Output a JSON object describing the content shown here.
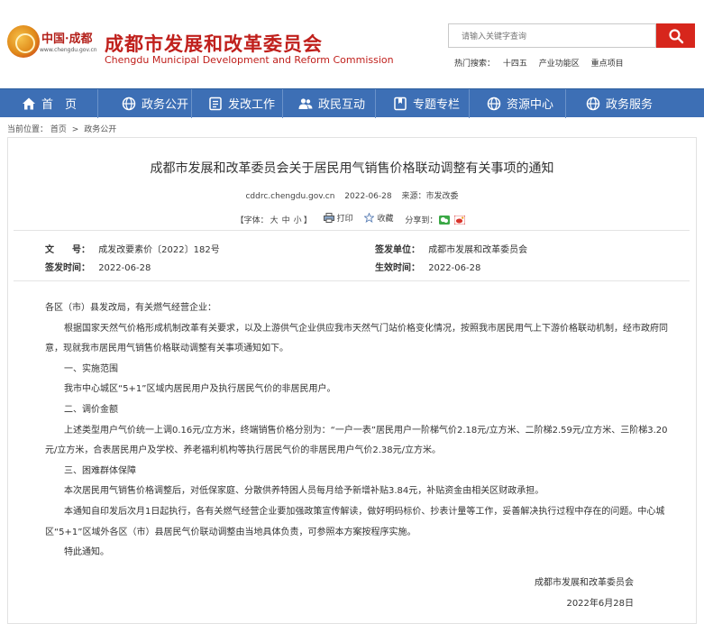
{
  "header": {
    "logo_text": "中国·成都",
    "logo_url": "www.chengdu.gov.cn",
    "title_cn": "成都市发展和改革委员会",
    "title_en": "Chengdu Municipal Development and Reform Commission",
    "search_placeholder": "请输入关键字查询",
    "hot_label": "热门搜索：",
    "hot_terms": [
      "十四五",
      "产业功能区",
      "重点项目"
    ]
  },
  "nav": {
    "items": [
      {
        "label": "首　页",
        "icon": "home-icon"
      },
      {
        "label": "政务公开",
        "icon": "globe-icon"
      },
      {
        "label": "发改工作",
        "icon": "folder-icon"
      },
      {
        "label": "政民互动",
        "icon": "users-icon"
      },
      {
        "label": "专题专栏",
        "icon": "bookmark-icon"
      },
      {
        "label": "资源中心",
        "icon": "globe-icon"
      },
      {
        "label": "政务服务",
        "icon": "globe-icon"
      }
    ]
  },
  "breadcrumb": {
    "label": "当前位置：",
    "items": [
      "首页",
      "政务公开"
    ],
    "sep": ">"
  },
  "article": {
    "title": "成都市发展和改革委员会关于居民用气销售价格联动调整有关事项的通知",
    "site": "cddrc.chengdu.gov.cn",
    "date": "2022-06-28",
    "source": "来源：市发改委",
    "font_label": "【字体：",
    "font_sizes": [
      "大",
      "中",
      "小"
    ],
    "font_close": "】",
    "print": "打印",
    "favorite": "收藏",
    "share": "分享到：",
    "doc_no_label": "文　　号：",
    "doc_no": "成发改要素价〔2022〕182号",
    "issuer_label": "签发单位：",
    "issuer": "成都市发展和改革委员会",
    "issue_date_label": "签发时间：",
    "issue_date": "2022-06-28",
    "effective_label": "生效时间：",
    "effective_date": "2022-06-28",
    "paragraphs": [
      {
        "text": "各区（市）县发改局，有关燃气经营企业：",
        "indent": false
      },
      {
        "text": "根据国家天然气价格形成机制改革有关要求，以及上游供气企业供应我市天然气门站价格变化情况，按照我市居民用气上下游价格联动机制，经市政府同意，现就我市居民用气销售价格联动调整有关事项通知如下。",
        "indent": true
      },
      {
        "text": "一、实施范围",
        "indent": true
      },
      {
        "text": "我市中心城区“5+1”区域内居民用户及执行居民气价的非居民用户。",
        "indent": true
      },
      {
        "text": "二、调价金额",
        "indent": true
      },
      {
        "text": "上述类型用户气价统一上调0.16元/立方米，终端销售价格分别为：“一户一表”居民用户一阶梯气价2.18元/立方米、二阶梯2.59元/立方米、三阶梯3.20元/立方米，合表居民用户及学校、养老福利机构等执行居民气价的非居民用户气价2.38元/立方米。",
        "indent": true
      },
      {
        "text": "三、困难群体保障",
        "indent": true
      },
      {
        "text": "本次居民用气销售价格调整后，对低保家庭、分散供养特困人员每月给予新增补贴3.84元，补贴资金由相关区财政承担。",
        "indent": true
      },
      {
        "text": "本通知自印发后次月1日起执行，各有关燃气经营企业要加强政策宣传解读，做好明码标价、抄表计量等工作，妥善解决执行过程中存在的问题。中心城区“5+1”区域外各区（市）县居民气价联动调整由当地具体负责，可参照本方案按程序实施。",
        "indent": true
      },
      {
        "text": "特此通知。",
        "indent": true
      }
    ],
    "sign_org": "成都市发展和改革委员会",
    "sign_date": "2022年6月28日"
  },
  "colors": {
    "brand_red": "#c0201c",
    "nav_blue": "#3d6fb5"
  }
}
